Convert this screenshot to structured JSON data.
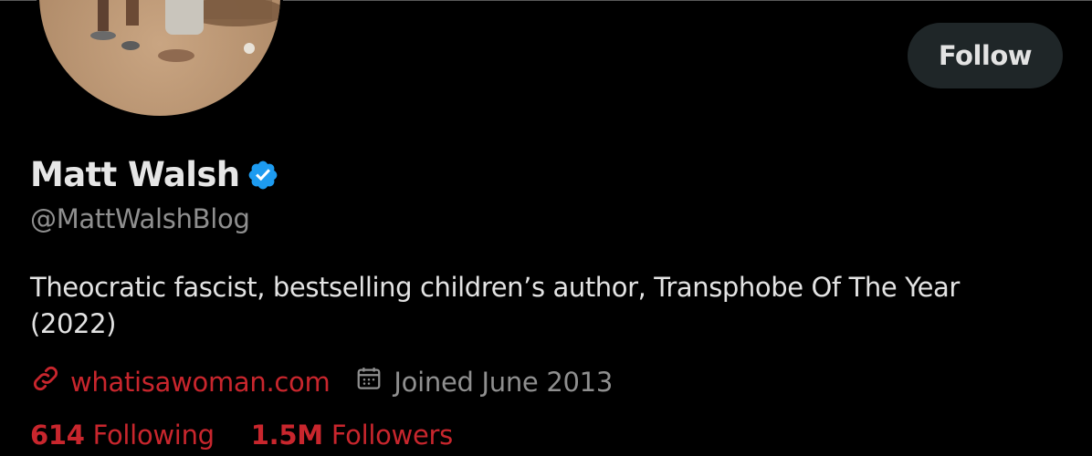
{
  "profile": {
    "display_name": "Matt Walsh",
    "handle": "@MattWalshBlog",
    "bio": "Theocratic fascist, bestselling children’s author, Transphobe Of The Year (2022)",
    "website": "whatisawoman.com",
    "joined": "Joined June 2013",
    "verified_icon": "verified-badge-icon"
  },
  "actions": {
    "follow_label": "Follow"
  },
  "stats": {
    "following_count": "614",
    "following_label": "Following",
    "followers_count": "1.5M",
    "followers_label": "Followers"
  },
  "colors": {
    "background": "#000000",
    "link": "#c8262d",
    "muted": "#8f8f8f",
    "verified": "#1d9bf0",
    "button_bg": "#1f2628"
  }
}
